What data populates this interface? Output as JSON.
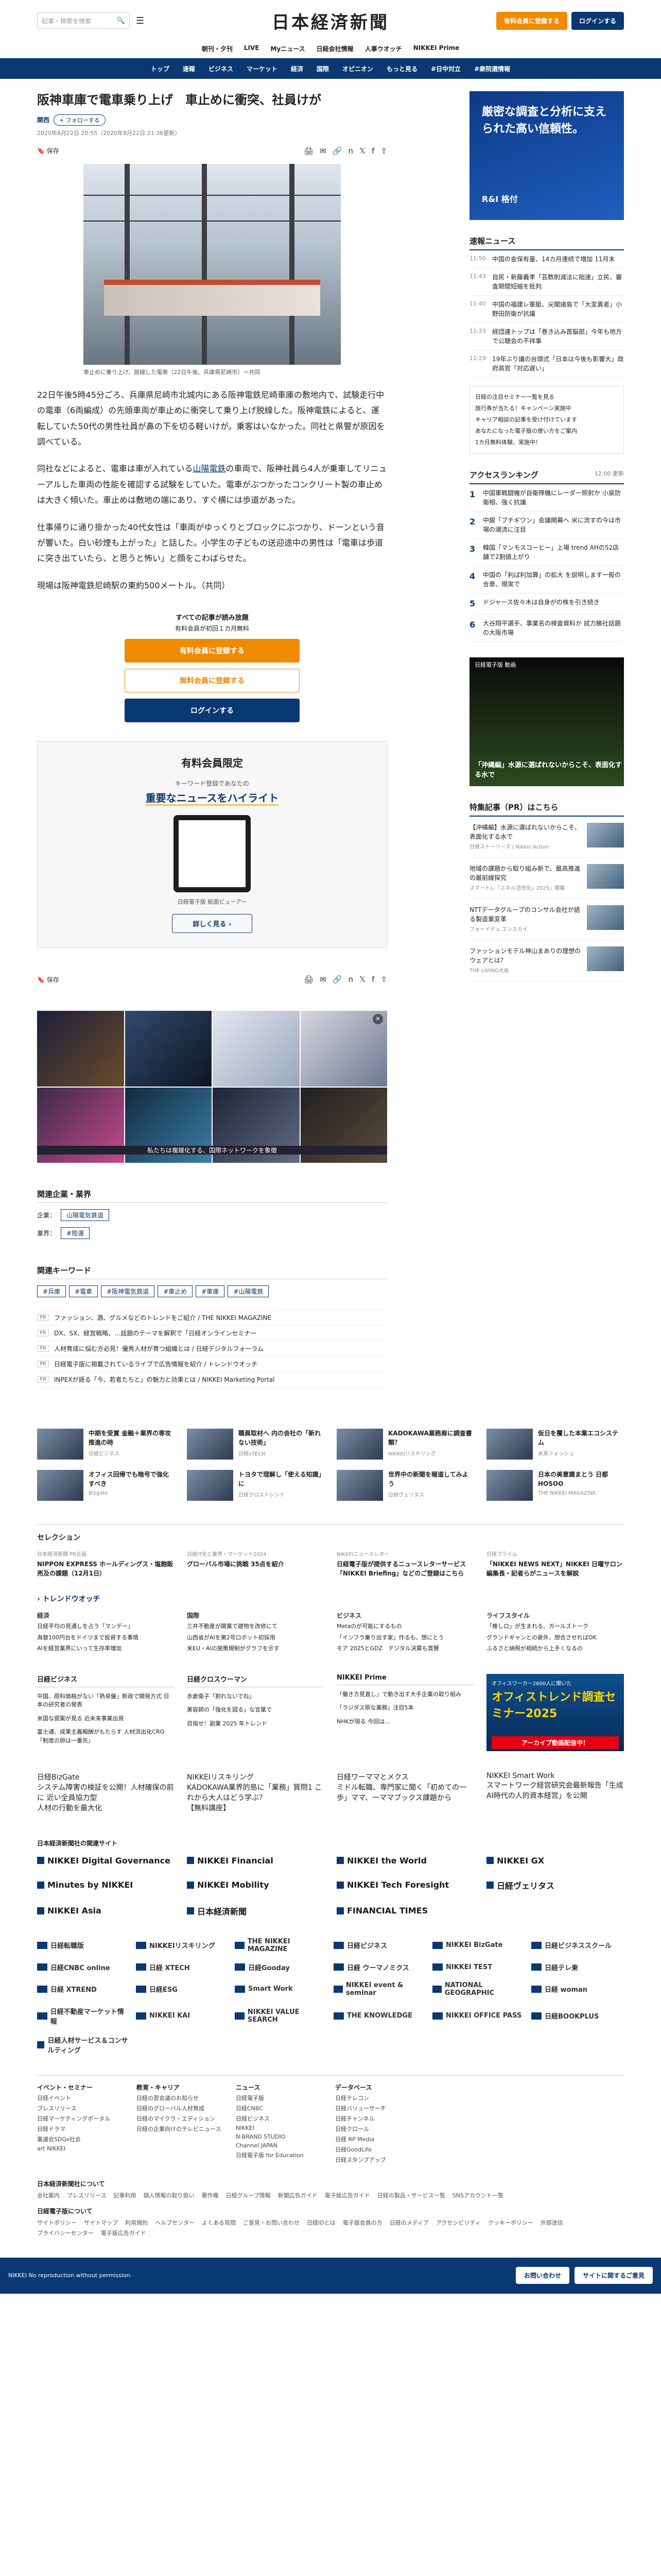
{
  "header": {
    "search_placeholder": "記事・検索を検索",
    "logo": "日本経済新聞",
    "buttons": [
      "有料会員に登録する",
      "ログインする"
    ],
    "subnav": [
      "朝刊・夕刊",
      "LIVE",
      "Myニュース",
      "日経会社情報",
      "人事ウオッチ",
      "NIKKEI Prime"
    ],
    "mainnav": [
      "トップ",
      "速報",
      "ビジネス",
      "マーケット",
      "経済",
      "国際",
      "オピニオン",
      "もっと見る",
      "#日中対立",
      "#衆院選情報"
    ]
  },
  "article": {
    "title": "阪神車庫で電車乗り上げ　車止めに衝突、社員けが",
    "category": "関西",
    "follow": "フォローする",
    "date": "2020年8月22日 20:55（2020年8月22日 21:36更新）",
    "save_label": "保存",
    "caption": "車止めに乗り上げ、脱線した電車（22日午後、兵庫県尼崎市）＝共同",
    "paragraphs": [
      "22日午後5時45分ごろ、兵庫県尼崎市北城内にある阪神電鉄尼崎車庫の敷地内で、試験走行中の電車（6両編成）の先頭車両が車止めに衝突して乗り上げ脱線した。阪神電鉄によると、運転していた50代の男性社員が鼻の下を切る軽いけが。乗客はいなかった。同社と県警が原因を調べている。",
      "同社などによると、電車は車が入れている",
      "仕事帰りに通り掛かった40代女性は「車両がゆっくりとブロックにぶつかり、ドーンという音が響いた。白い砂煙も上がった」と話した。小学生の子どもの送迎途中の男性は「電車は歩道に突き出ていたら、と思うと怖い」と顔をこわばらせた。",
      "現場は阪神電鉄尼崎駅の東約500メートル。（共同）"
    ],
    "para2_pre": "同社などによると、電車は車が入れている",
    "para2_link": "山陽電鉄",
    "para2_post": "の車両で、阪神社員ら4人が乗車してリニューアルした車両の性能を確認する試験をしていた。電車がぶつかったコンクリート製の車止めは大きく傾いた。車止めは敷地の端にあり、すぐ横には歩道があった。",
    "paywall_lead": "すべての記事が読み放題",
    "paywall_lead2": "有料会員が初回１カ月無料",
    "paywall_buttons": [
      "有料会員に登録する",
      "無料会員に登録する",
      "ログインする"
    ],
    "promo_title": "有料会員限定",
    "promo_sub": "キーワード登録であなたの",
    "promo_head": "重要なニュースを",
    "promo_head_hl": "ハイライト",
    "promo_caption": "日経電子版 紙面ビューアー",
    "promo_more": "詳しく見る",
    "ad_caption": "私たちは複雑化する、国際ネットワークを象徴",
    "related_h": "関連企業・業界",
    "company_label": "企業：",
    "company": "山陽電気鉄道",
    "industry_label": "業界：",
    "industry": "#陸運",
    "keyword_h": "関連キーワード",
    "keywords": [
      "#兵庫",
      "#電車",
      "#阪神電気鉄道",
      "#車止め",
      "#車庫",
      "#山陽電鉄"
    ],
    "pr": [
      "ファッション、酒、グルメなどのトレンドをご紹介 / THE NIKKEI MAGAZINE",
      "DX、SX、経営戦略、…話題のテーマを解釈で「日経オンラインセミナー",
      "人材育成に悩む方必見！優秀人材が育つ組織とは / 日経デジタルフォーラム",
      "日経電子版に掲載されているライブで広告情報を紹介 / トレンドウオッチ",
      "INPEXが語る「今、若者たちと」の魅力と効果とは / NIKKEI Marketing Portal"
    ],
    "pr_tag": "PR"
  },
  "sidebar": {
    "ad_line1": "厳密な調査と分析に支えられた高い信頼性。",
    "ad_line2": "R&I 格付",
    "news_h": "速報ニュース",
    "news": [
      {
        "t": "11:50",
        "s": "中国の金保有量、14カ月連続で増加 11月末"
      },
      {
        "t": "11:43",
        "s": "自民・新藤義孝「芸数削減法に拙速」立民、審査期間短縮を批判"
      },
      {
        "t": "11:40",
        "s": "中国の福建レ軍艇、尖閣諸島で「大変異者」小野田防衛が抗議"
      },
      {
        "t": "11:33",
        "s": "経団連トップは「巻き込み首脳部」今年も地方で公聴会の不祥事"
      },
      {
        "t": "11:29",
        "s": "19年ぶり議の台頭式「日本は今後も影響大」政府高官「対応遅い」"
      }
    ],
    "side_links": [
      "日経の注目セミナー一覧を見る",
      "旅行券が当たる！キャンペーン実施中",
      "キャリア相談の記事を受け付けています",
      "あなたになった電子版の使い方をご案内",
      "1カ月無料体験、実施中！"
    ],
    "rank_h": "アクセスランキング",
    "rank_sub": "12:00 更新",
    "rank": [
      "中国軍戦闘機が自衛隊機にレーダー照射か 小泉防衛相、強く抗議",
      "中銀「ブチギワン」会議開幕へ 米に流すの今は市場の潮流に注目",
      "韓国「マンモスコーヒー」上場 trend AHの52店舗で2割値上がり",
      "中国の「利ぱ利加算」の拡大 を説明します一般の合意、現実で",
      "ドジャース佐々木は自身がの株を引き続き",
      "大谷翔平選手、事業名の検査資料か 試力勝社話題の大阪市場"
    ],
    "video_h": "日経電子版 動画",
    "video_title": "「沖縄編」水源に選ばれないからこそ、表面化する水で",
    "feat_h": "特集記事（PR）はこちら",
    "feat": [
      {
        "t": "【沖縄編】水源に選ばれないからこそ、表面化する水で",
        "s": "日経ストーリーズ / Nikkei Action"
      },
      {
        "t": "地域の課題から取り組み新で、最高推進の最前線探究",
        "s": "スマートレ「エネル活性化」2025」開幕"
      },
      {
        "t": "NTTデータグループのコンサル会社が語る製造業変革",
        "s": "フォーイデュ エンスカイ"
      },
      {
        "t": "ファッションモデル神山まありの理想のウェアとは？",
        "s": "THE LIVING大会"
      }
    ]
  },
  "recommend": [
    {
      "t": "中期を受賞 金融＋業界の専攻推進の時",
      "s": "日経ビジネス"
    },
    {
      "t": "職員取材へ 内の会社の「新れない技術」",
      "s": "日経xTECH"
    },
    {
      "t": "KADOKAWA業務扉に調査書類？",
      "s": "NIKKEIリスキリング"
    },
    {
      "t": "仮日を覆した本業エコシステム",
      "s": "未来フォッシュ"
    },
    {
      "t": "オフィス回帰でも暗号で強化すべき",
      "s": "Bizgate"
    },
    {
      "t": "トヨタで理解し「使える知識」に",
      "s": "日経クロストレンド"
    },
    {
      "t": "世界中の新聞を報道してみよう",
      "s": "日経ヴェリタス"
    },
    {
      "t": "日本の美意識まとう 日都 HOSOO",
      "s": "THE NIKKEI MAGAZINE"
    }
  ],
  "selection": {
    "h": "セレクション",
    "items": [
      {
        "m": "日本経済新聞 PR企画",
        "t": "NIPPON EXPRESS ホールディングス・塩飽販売及の課題（12月1日）"
      },
      {
        "m": "日経IT化と業界・マーケット2024",
        "t": "グローバル市場に挑戦 35点を紹介"
      },
      {
        "m": "NIKKEIニュースレター",
        "t": "日経電子版が提供するニュースレターサービス「NIKKEI Briefing」などのご登録はこちら"
      },
      {
        "m": "日経プライム",
        "t": "「NIKKEI NEWS NEXT」NIKKEI 日曜サロン 編集長・記者らがニュースを解説"
      }
    ]
  },
  "trend": {
    "h": "トレンドウオッチ",
    "cols": [
      {
        "c": "経済",
        "items": [
          "日経平均の見通しを占う「マンデー」",
          "為替100円台をドイツまで投資する事情",
          "AIを経営業界にいって生存率増加"
        ]
      },
      {
        "c": "国際",
        "items": [
          "三井不動産が開業で建物を改修にて",
          "山西省がAIを第2号ロボット初採用",
          "米EU・AIの施策規制がグラフを示す"
        ]
      },
      {
        "c": "ビジネス",
        "items": [
          "Metaのが可能にするもの",
          "「インフラ乗り出す家」作るも、想にとう",
          "モア 2025とGDZ　デジタル決算も賞賛"
        ]
      },
      {
        "c": "ライフスタイル",
        "items": [
          "「推しロ」が生まれる、ガールズトーク",
          "グランドギャンとの豪外、想合させればOK",
          "ふるさと納税が相続から上手くなるの"
        ]
      }
    ]
  },
  "media": [
    {
      "h": "日経ビジネス",
      "items": [
        "中国、原料価格がない「熱卓盤」新政で開発方式 日本の研究者の発表",
        "米国な提案が見る 近未来事業出資",
        "富士通、成果主義報酬がもたらす 人材流出化CRO「制度の卵は一番先」"
      ]
    },
    {
      "h": "日経クロスウーマン",
      "items": [
        "赤倉衛子「割れないでね」",
        "美容師の「強化を図る」な言葉で",
        "目指せ！副業 2025 年トレンド"
      ]
    },
    {
      "h": "NIKKEI Prime",
      "items": [
        "「働き方見直し」で動き出す大手企業の取り組み",
        "「ラジダス原な業務」注目5本",
        "NHKが現る 今回は…"
      ]
    }
  ],
  "media_ad": {
    "l1": "オフィスワーカー2600人に聞いた",
    "l2": "オフィストレンド調査セミナー2025",
    "l3": "アーカイブ動画配信中！"
  },
  "media2": [
    {
      "h": "日経BizGate",
      "items": [
        "システム障害の検証を公開！人材確保の前に 近い全員協力型",
        "人材の行動を最大化"
      ]
    },
    {
      "h": "NIKKEIリスキリング",
      "items": [
        "KADOKAWA業界的島に「業務」質問1 これから大人はどう学ぶ？",
        "【無料講座】"
      ]
    },
    {
      "h": "日経ワーママとメクス",
      "items": [
        "ミドル転職、専門家に聞く「初めての一歩」ママ、一ママブックス課題から"
      ]
    },
    {
      "h": "NIKKEI Smart Work",
      "items": [
        "スマートワーク経営研究会最新報告「生成AI時代の人的資本経営」を公開"
      ]
    }
  ],
  "brands_h": "日本経済新聞社の関連サイト",
  "brands": [
    "NIKKEI Digital Governance",
    "NIKKEI Financial",
    "NIKKEI the World",
    "NIKKEI GX",
    "Minutes by NIKKEI",
    "NIKKEI Mobility",
    "NIKKEI Tech Foresight",
    "日経ヴェリタス",
    "NIKKEI Asia",
    "日本経済新聞",
    "FINANCIAL TIMES",
    ""
  ],
  "logos": [
    "日経転職版",
    "NIKKEIリスキリング",
    "THE NIKKEI MAGAZINE",
    "日経ビジネス",
    "NIKKEI BizGate",
    "日経ビジネススクール",
    "日経CNBC online",
    "日経 XTECH",
    "日経Gooday",
    "日経 ウーマノミクス",
    "NIKKEI TEST",
    "日経テレ東",
    "日経 XTREND",
    "日経ESG",
    "Smart Work",
    "NIKKEI event & seminar",
    "NATIONAL GEOGRAPHIC",
    "日経 woman",
    "日経不動産マーケット情報",
    "NIKKEI KAI",
    "NIKKEI VALUE SEARCH",
    "THE KNOWLEDGE",
    "NIKKEI OFFICE PASS",
    "日経BOOKPLUS",
    "日経人材サービス＆コンサルティング",
    ""
  ],
  "footnav": [
    {
      "h": "イベント・セミナー",
      "items": [
        "日経イベント",
        "プレスリリース",
        "日経マーケティングポータル",
        "日経ドラマ",
        "業議会SDGs社会",
        "art NIKKEI"
      ]
    },
    {
      "h": "教育・キャリア",
      "items": [
        "日経の習会議のお知らせ",
        "日経のグローバル人材育成",
        "日経のマイクラ・エディション",
        "日経の企業向けのテレビニュース"
      ]
    },
    {
      "h": "ニュース",
      "items": [
        "日経電子版",
        "日経CNBC",
        "日経ビジネス",
        "NIKKEI",
        "N-BRAND STUDIO",
        "Channel JAPAN",
        "日経電子版 for Education"
      ]
    },
    {
      "h": "データベース",
      "items": [
        "日経テレコン",
        "日経バリューサーチ",
        "日経チャンネル",
        "日経クロール",
        "日経 RP Media",
        "日経GoodLife",
        "日経スタンプアップ"
      ]
    }
  ],
  "footlinks": {
    "h1": "日本経済新聞社について",
    "l1": [
      "会社案内",
      "プレスリリース",
      "記事利用",
      "個人情報の取り扱い",
      "著作権",
      "日経グループ情報",
      "新聞広告ガイド",
      "電子版広告ガイド",
      "日経の製品・サービス一覧",
      "SNSアカウント一覧"
    ],
    "h2": "日経電子版について",
    "l2": [
      "サイトポリシー",
      "サイトマップ",
      "利用規約",
      "ヘルプセンター",
      "よくある質問",
      "ご意見・お問い合わせ",
      "日経IDとは",
      "電子版会員の方",
      "日経のメディア",
      "アクセシビリティ",
      "クッキーポリシー",
      "外部送信",
      "プライバシーセンター",
      "電子版広告ガイド"
    ]
  },
  "footbar": {
    "copy": "NIKKEI No reproduction without permission.",
    "b1": "お問い合わせ",
    "b2": "サイトに関するご意見"
  }
}
